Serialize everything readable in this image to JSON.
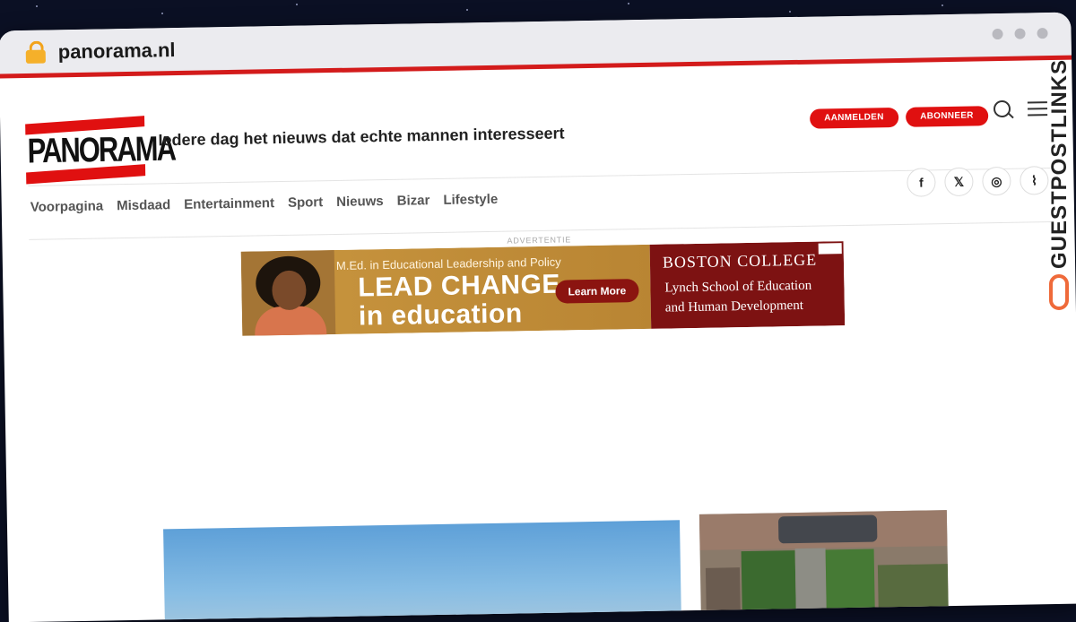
{
  "browser": {
    "url": "panorama.nl"
  },
  "header": {
    "logo_text": "PANORAMA",
    "tagline": "Iedere dag het nieuws dat echte mannen interesseert",
    "login_label": "AANMELDEN",
    "subscribe_label": "ABONNEER"
  },
  "nav": {
    "items": [
      "Voorpagina",
      "Misdaad",
      "Entertainment",
      "Sport",
      "Nieuws",
      "Bizar",
      "Lifestyle"
    ]
  },
  "social": {
    "facebook": "f",
    "x": "𝕏",
    "instagram": "◎",
    "rss": "⌇"
  },
  "ad": {
    "label": "ADVERTENTIE",
    "subtitle": "M.Ed. in Educational Leadership and Policy",
    "headline_line1": "LEAD CHANGE",
    "headline_line2": "in education",
    "cta": "Learn More",
    "college": "BOSTON COLLEGE",
    "school_line1": "Lynch School of Education",
    "school_line2": "and Human Development"
  },
  "watermark": {
    "text": "GUESTPOSTLINKS"
  },
  "colors": {
    "brand_red": "#e01010",
    "accent_orange": "#ef6a3a"
  }
}
